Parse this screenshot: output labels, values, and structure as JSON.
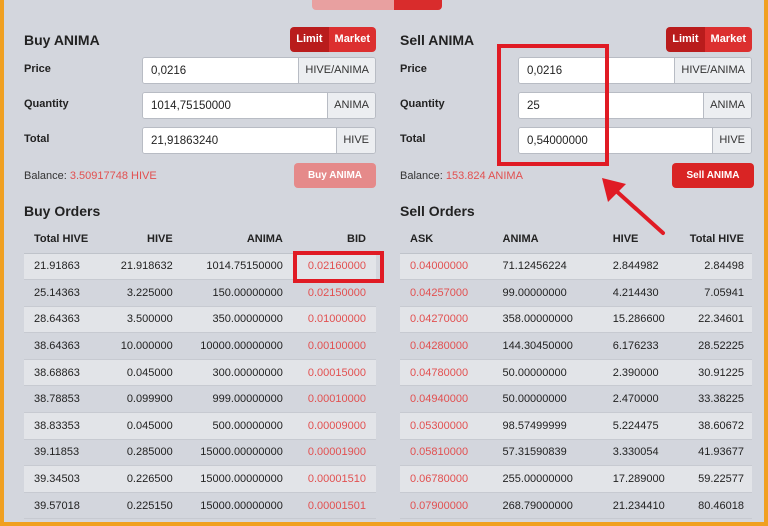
{
  "buy_panel": {
    "title": "Buy ANIMA",
    "mode_limit": "Limit",
    "mode_market": "Market",
    "price_label": "Price",
    "price_value": "0,0216",
    "price_unit": "HIVE/ANIMA",
    "quantity_label": "Quantity",
    "quantity_value": "1014,75150000",
    "quantity_unit": "ANIMA",
    "total_label": "Total",
    "total_value": "21,91863240",
    "total_unit": "HIVE",
    "balance_label": "Balance:",
    "balance_value": "3.50917748 HIVE",
    "action_label": "Buy ANIMA"
  },
  "sell_panel": {
    "title": "Sell ANIMA",
    "mode_limit": "Limit",
    "mode_market": "Market",
    "price_label": "Price",
    "price_value": "0,0216",
    "price_unit": "HIVE/ANIMA",
    "quantity_label": "Quantity",
    "quantity_value": "25",
    "quantity_unit": "ANIMA",
    "total_label": "Total",
    "total_value": "0,54000000",
    "total_unit": "HIVE",
    "balance_label": "Balance:",
    "balance_value": "153.824 ANIMA",
    "action_label": "Sell ANIMA"
  },
  "buy_orders": {
    "title": "Buy Orders",
    "headers": [
      "Total HIVE",
      "HIVE",
      "ANIMA",
      "BID"
    ],
    "rows": [
      [
        "21.91863",
        "21.918632",
        "1014.75150000",
        "0.02160000"
      ],
      [
        "25.14363",
        "3.225000",
        "150.00000000",
        "0.02150000"
      ],
      [
        "28.64363",
        "3.500000",
        "350.00000000",
        "0.01000000"
      ],
      [
        "38.64363",
        "10.000000",
        "10000.00000000",
        "0.00100000"
      ],
      [
        "38.68863",
        "0.045000",
        "300.00000000",
        "0.00015000"
      ],
      [
        "38.78853",
        "0.099900",
        "999.00000000",
        "0.00010000"
      ],
      [
        "38.83353",
        "0.045000",
        "500.00000000",
        "0.00009000"
      ],
      [
        "39.11853",
        "0.285000",
        "15000.00000000",
        "0.00001900"
      ],
      [
        "39.34503",
        "0.226500",
        "15000.00000000",
        "0.00001510"
      ],
      [
        "39.57018",
        "0.225150",
        "15000.00000000",
        "0.00001501"
      ]
    ]
  },
  "sell_orders": {
    "title": "Sell Orders",
    "headers": [
      "ASK",
      "ANIMA",
      "HIVE",
      "Total HIVE"
    ],
    "rows": [
      [
        "0.04000000",
        "71.12456224",
        "2.844982",
        "2.84498"
      ],
      [
        "0.04257000",
        "99.00000000",
        "4.214430",
        "7.05941"
      ],
      [
        "0.04270000",
        "358.00000000",
        "15.286600",
        "22.34601"
      ],
      [
        "0.04280000",
        "144.30450000",
        "6.176233",
        "28.52225"
      ],
      [
        "0.04780000",
        "50.00000000",
        "2.390000",
        "30.91225"
      ],
      [
        "0.04940000",
        "50.00000000",
        "2.470000",
        "33.38225"
      ],
      [
        "0.05300000",
        "98.57499999",
        "5.224475",
        "38.60672"
      ],
      [
        "0.05810000",
        "57.31590839",
        "3.330054",
        "41.93677"
      ],
      [
        "0.06780000",
        "255.00000000",
        "17.289000",
        "59.22577"
      ],
      [
        "0.07900000",
        "268.79000000",
        "21.234410",
        "80.46018"
      ]
    ]
  },
  "colors": {
    "accent_red": "#dc2f2f",
    "price_red": "#e25050",
    "highlight_red": "#e01b24",
    "background": "#d3d6dd",
    "outer_frame": "#f0a020"
  },
  "icons": {
    "annotation_arrow": "arrow-up-left-icon"
  }
}
